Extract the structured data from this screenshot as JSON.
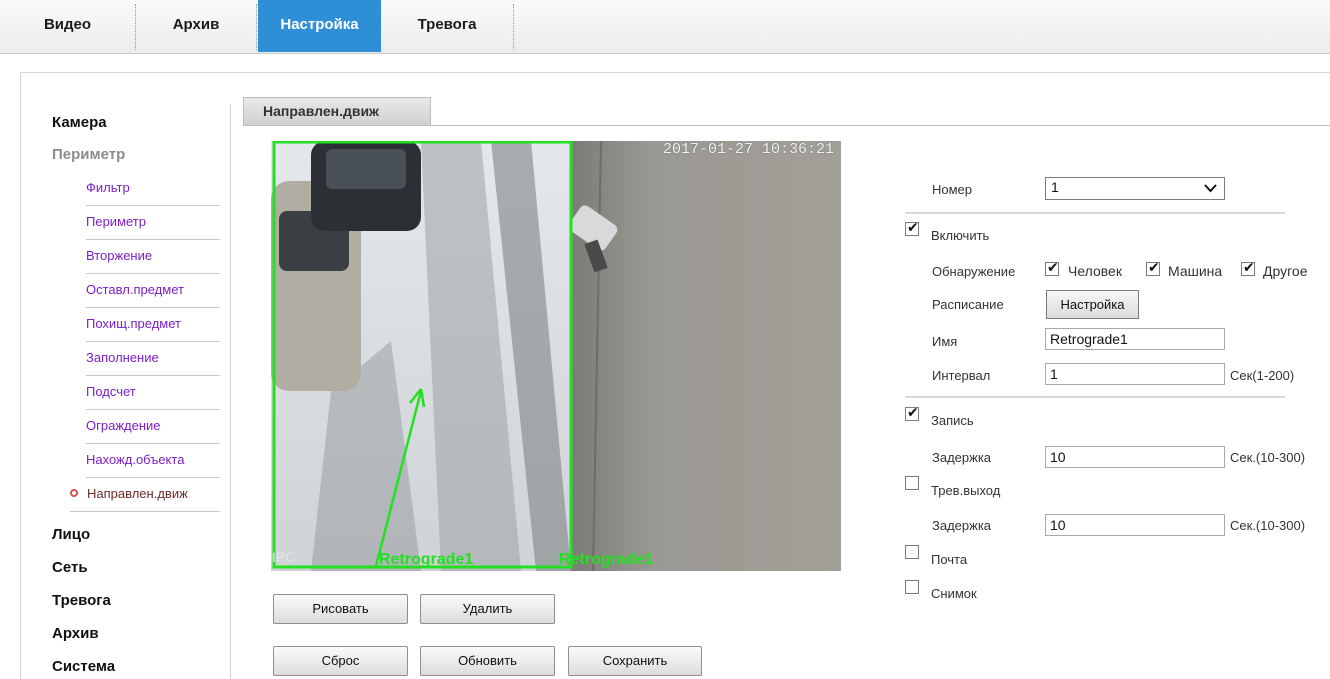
{
  "nav": {
    "tabs": [
      {
        "label": "Видео",
        "active": false
      },
      {
        "label": "Архив",
        "active": false
      },
      {
        "label": "Настройка",
        "active": true
      },
      {
        "label": "Тревога",
        "active": false
      }
    ]
  },
  "sidebar": {
    "categories": {
      "camera": "Камера",
      "perimeter": "Периметр",
      "face": "Лицо",
      "network": "Сеть",
      "alarm": "Тревога",
      "archive": "Архив",
      "system": "Система"
    },
    "items": [
      {
        "label": "Фильтр"
      },
      {
        "label": "Периметр"
      },
      {
        "label": "Вторжение"
      },
      {
        "label": "Оставл.предмет"
      },
      {
        "label": "Похищ.предмет"
      },
      {
        "label": "Заполнение"
      },
      {
        "label": "Подсчет"
      },
      {
        "label": "Ограждение"
      },
      {
        "label": "Нахожд.объекта"
      },
      {
        "label": "Направлен.движ",
        "active": true
      }
    ]
  },
  "panel": {
    "title": "Направлен.движ"
  },
  "video": {
    "timestamp": "2017-01-27 10:36:21",
    "zone_label_1": "Retrograde1",
    "zone_label_2": "Retrograde1",
    "channel_label": "IPC"
  },
  "actions": {
    "draw": "Рисовать",
    "delete": "Удалить",
    "reset": "Сброс",
    "refresh": "Обновить",
    "save": "Сохранить"
  },
  "form": {
    "number_label": "Номер",
    "number_value": "1",
    "enable_label": "Включить",
    "enable_checked": true,
    "detection_label": "Обнаружение",
    "detection_options": [
      {
        "label": "Человек",
        "checked": true
      },
      {
        "label": "Машина",
        "checked": true
      },
      {
        "label": "Другое",
        "checked": true
      }
    ],
    "schedule_label": "Расписание",
    "schedule_button": "Настройка",
    "name_label": "Имя",
    "name_value": "Retrograde1",
    "interval_label": "Интервал",
    "interval_value": "1",
    "interval_unit": "Сек(1-200)",
    "record_label": "Запись",
    "record_checked": true,
    "record_delay_label": "Задержка",
    "record_delay_value": "10",
    "record_delay_unit": "Сек.(10-300)",
    "alarm_out_label": "Трев.выход",
    "alarm_out_checked": false,
    "alarm_delay_label": "Задержка",
    "alarm_delay_value": "10",
    "alarm_delay_unit": "Сек.(10-300)",
    "mail_label": "Почта",
    "mail_checked": false,
    "snapshot_label": "Снимок",
    "snapshot_checked": false
  },
  "colors": {
    "accent": "#2f8fd6",
    "zone_line": "#22e022",
    "link": "#7b1fc8"
  }
}
